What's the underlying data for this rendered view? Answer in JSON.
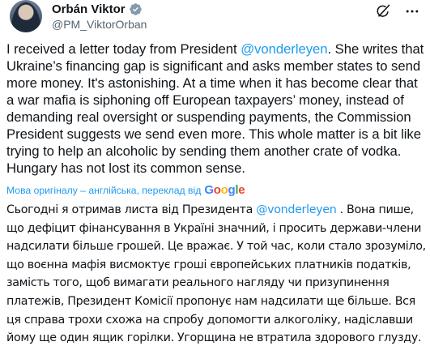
{
  "author": {
    "name": "Orbán Viktor",
    "handle": "@PM_ViktorOrban",
    "avatar_icon": "avatar-photo",
    "verified_icon": "verified-badge-icon",
    "verified_color": "#829aab"
  },
  "actions": {
    "icons": [
      "grok-icon",
      "more-icon"
    ]
  },
  "tweet": {
    "part1": "I received a letter today from President ",
    "mention": "@vonderleyen",
    "part2": ". She writes that Ukraine’s financing gap is significant and asks member states to send more money. It's astonishing. At a time when it has become clear that a war mafia is siphoning off European taxpayers’ money, instead of demanding real oversight or suspending payments, the Commission President suggests we send even more. This whole matter is a bit like trying to help an alcoholic by sending them another crate of vodka. Hungary has not lost its common sense."
  },
  "translation": {
    "label": "Мова оригіналу – англійська, переклад від",
    "provider": "Google",
    "part1": "Сьогодні я отримав листа від Президента ",
    "mention": "@vonderleyen",
    "part2": " . Вона пише, що дефіцит фінансування в Україні значний, і просить держави-члени надсилати більше грошей. Це вражає. У той час, коли стало зрозуміло, що воєнна мафія висмоктує гроші європейських платників податків, замість того, щоб вимагати реального нагляду чи призупинення платежів, Президент Комісії пропонує нам надсилати ще більше. Вся ця справа трохи схожа на спробу допомогти алкоголіку, надіславши йому ще один ящик горілки. Угорщина не втратила здорового глузду."
  },
  "colors": {
    "link": "#1d9bf0",
    "text": "#0f1419",
    "secondary": "#536471"
  }
}
